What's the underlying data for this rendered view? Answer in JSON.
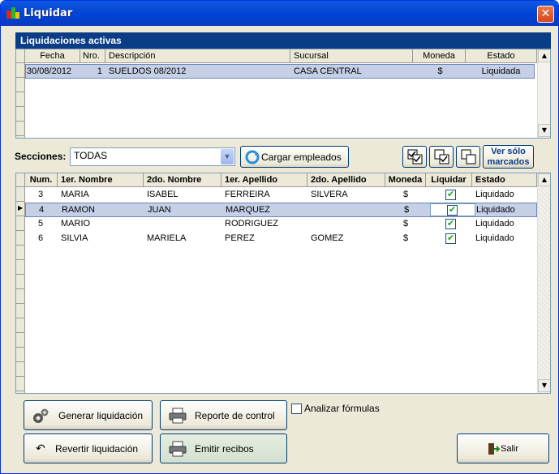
{
  "window": {
    "title": "Liquidar",
    "close_glyph": "✕"
  },
  "liquidaciones": {
    "header": "Liquidaciones activas",
    "columns": [
      "Fecha",
      "Nro.",
      "Descripción",
      "Sucursal",
      "Moneda",
      "Estado"
    ],
    "rows": [
      {
        "fecha": "30/08/2012",
        "nro": "1",
        "descripcion": "SUELDOS 08/2012",
        "sucursal": "CASA CENTRAL",
        "moneda": "$",
        "estado": "Liquidada"
      }
    ]
  },
  "secciones": {
    "label": "Secciones:",
    "value": "TODAS"
  },
  "toolbar": {
    "cargar_label": "Cargar empleados",
    "ver_solo_line1": "Ver sólo",
    "ver_solo_line2": "marcados"
  },
  "empleados": {
    "columns": [
      "Num.",
      "1er. Nombre",
      "2do. Nombre",
      "1er. Apellido",
      "2do. Apellido",
      "Moneda",
      "Liquidar",
      "Estado"
    ],
    "rows": [
      {
        "num": "3",
        "nombre1": "MARIA",
        "nombre2": "ISABEL",
        "apellido1": "FERREIRA",
        "apellido2": "SILVERA",
        "moneda": "$",
        "liquidar": true,
        "estado": "Liquidado"
      },
      {
        "num": "4",
        "nombre1": "RAMON",
        "nombre2": "JUAN",
        "apellido1": "MARQUEZ",
        "apellido2": "",
        "moneda": "$",
        "liquidar": true,
        "estado": "Liquidado"
      },
      {
        "num": "5",
        "nombre1": "MARIO",
        "nombre2": "",
        "apellido1": "RODRIGUEZ",
        "apellido2": "",
        "moneda": "$",
        "liquidar": true,
        "estado": "Liquidado"
      },
      {
        "num": "6",
        "nombre1": "SILVIA",
        "nombre2": "MARIELA",
        "apellido1": "PEREZ",
        "apellido2": "GOMEZ",
        "moneda": "$",
        "liquidar": true,
        "estado": "Liquidado"
      }
    ]
  },
  "actions": {
    "generar": "Generar liquidación",
    "reporte": "Reporte de control",
    "revertir": "Revertir liquidación",
    "emitir": "Emitir recibos",
    "analizar": "Analizar fórmulas",
    "salir": "Salir"
  },
  "colors": {
    "accent": "#0b3c86",
    "selection": "#c5d0e7",
    "window_bg": "#ece9d8"
  }
}
